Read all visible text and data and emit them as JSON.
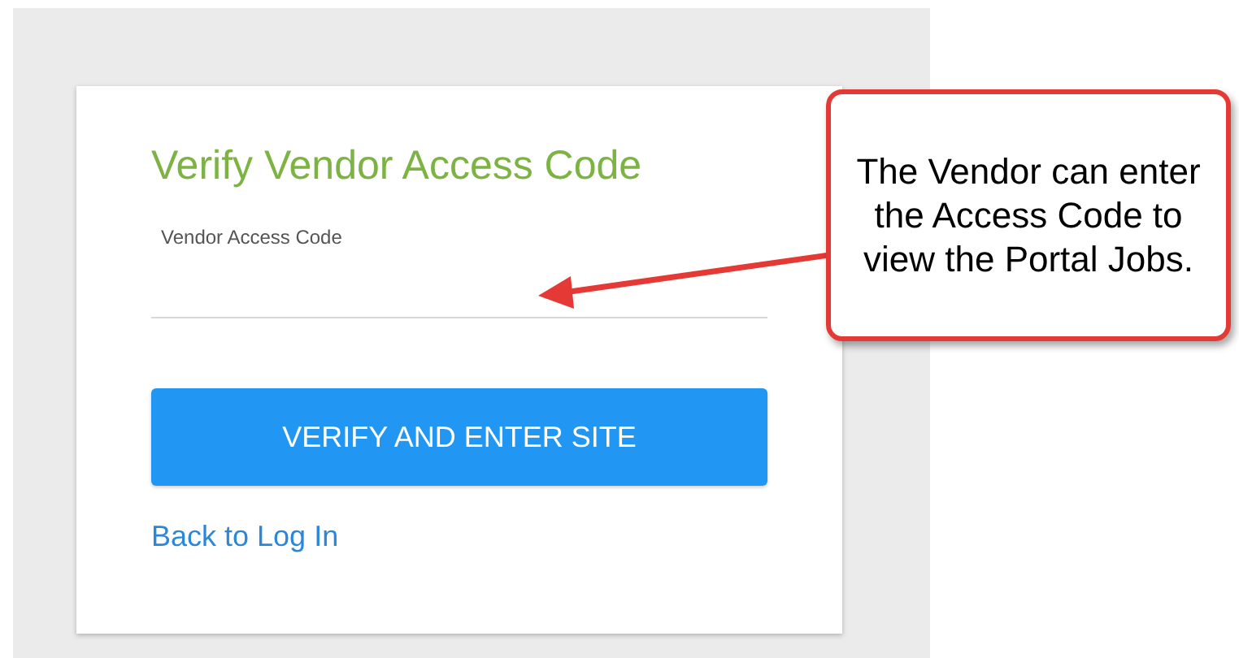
{
  "form": {
    "title": "Verify Vendor Access Code",
    "field_label": "Vendor Access Code",
    "button": "VERIFY AND ENTER SITE",
    "link": "Back to Log In"
  },
  "callout": {
    "text": "The Vendor can enter the Access Code to view the Portal Jobs."
  }
}
